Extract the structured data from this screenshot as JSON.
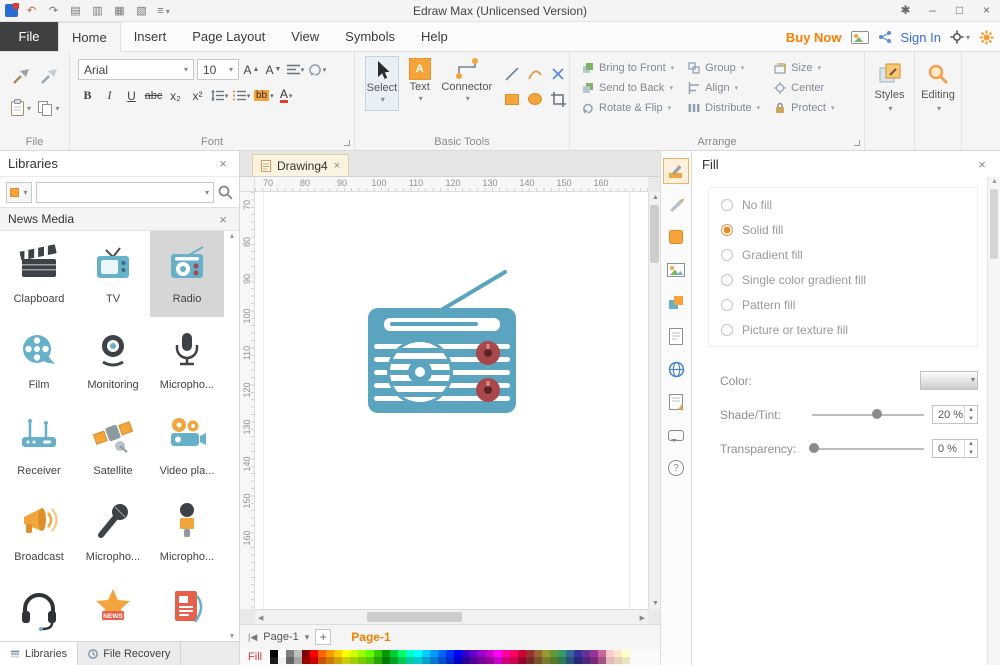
{
  "titlebar": {
    "title": "Edraw Max (Unlicensed Version)"
  },
  "tabs": {
    "file": "File",
    "items": [
      "Home",
      "Insert",
      "Page Layout",
      "View",
      "Symbols",
      "Help"
    ],
    "buy_now": "Buy Now",
    "sign_in": "Sign In"
  },
  "ribbon": {
    "groups": {
      "file": "File",
      "font": "Font",
      "basic_tools": "Basic Tools",
      "arrange": "Arrange"
    },
    "font": {
      "family": "Arial",
      "size": "10",
      "bold": "B",
      "italic": "I",
      "underline": "U",
      "strike": "abc",
      "subscript": "x₂",
      "superscript": "x²",
      "highlight": "bb",
      "color": "A"
    },
    "tools": {
      "select": "Select",
      "text": "Text",
      "connector": "Connector"
    },
    "arrange": {
      "bring_to_front": "Bring to Front",
      "send_to_back": "Send to Back",
      "rotate_flip": "Rotate & Flip",
      "group": "Group",
      "align": "Align",
      "distribute": "Distribute",
      "size": "Size",
      "center": "Center",
      "protect": "Protect"
    },
    "styles": "Styles",
    "editing": "Editing"
  },
  "library": {
    "title": "Libraries",
    "section": "News Media",
    "items": [
      {
        "label": "Clapboard"
      },
      {
        "label": "TV"
      },
      {
        "label": "Radio",
        "selected": true
      },
      {
        "label": "Film"
      },
      {
        "label": "Monitoring"
      },
      {
        "label": "Micropho..."
      },
      {
        "label": "Receiver"
      },
      {
        "label": "Satellite"
      },
      {
        "label": "Video pla..."
      },
      {
        "label": "Broadcast"
      },
      {
        "label": "Micropho..."
      },
      {
        "label": "Micropho..."
      },
      {
        "label": ""
      },
      {
        "label": ""
      },
      {
        "label": ""
      }
    ],
    "tabs": [
      "Libraries",
      "File Recovery"
    ]
  },
  "canvas": {
    "doc_tab": "Drawing4",
    "h_ruler": [
      "70",
      "80",
      "90",
      "100",
      "110",
      "120",
      "130",
      "140",
      "150",
      "160"
    ],
    "v_ruler": [
      "70",
      "80",
      "90",
      "100",
      "110",
      "120",
      "130",
      "140",
      "150",
      "160"
    ],
    "page_nav_label": "Page-1",
    "active_page": "Page-1",
    "add_page": "+"
  },
  "fill_panel": {
    "title": "Fill",
    "options": [
      {
        "label": "No fill",
        "selected": false
      },
      {
        "label": "Solid fill",
        "selected": true
      },
      {
        "label": "Gradient fill",
        "selected": false
      },
      {
        "label": "Single color gradient fill",
        "selected": false
      },
      {
        "label": "Pattern fill",
        "selected": false
      },
      {
        "label": "Picture or texture fill",
        "selected": false
      }
    ],
    "color_label": "Color:",
    "shade_label": "Shade/Tint:",
    "shade_value": "20 %",
    "shade_percent": 58,
    "transparency_label": "Transparency:",
    "transparency_value": "0 %",
    "transparency_percent": 2
  },
  "bottom": {
    "fill_label": "Fill",
    "palette_row1": [
      "#000000",
      "#ffffff",
      "#808080",
      "#c0c0c0",
      "#800000",
      "#ff0000",
      "#ff6600",
      "#ff9900",
      "#ffcc00",
      "#ffff00",
      "#ccff00",
      "#99ff00",
      "#66ff00",
      "#33cc00",
      "#009900",
      "#00cc33",
      "#00ff66",
      "#00ffcc",
      "#00ffff",
      "#00ccff",
      "#0099ff",
      "#0066ff",
      "#0033ff",
      "#0000ff",
      "#3300cc",
      "#6600cc",
      "#9900cc",
      "#cc00cc",
      "#ff00ff",
      "#ff0099",
      "#ff0066",
      "#cc0033",
      "#993333",
      "#996633",
      "#999933",
      "#669933",
      "#339966",
      "#336699",
      "#333399",
      "#663399",
      "#993399",
      "#cc6699",
      "#ffcccc",
      "#ffe5cc",
      "#ffffcc"
    ],
    "palette_row2": [
      "#1a1a1a",
      "#f2f2f2",
      "#666666",
      "#a6a6a6",
      "#990000",
      "#cc0000",
      "#cc5200",
      "#cc7a00",
      "#cca300",
      "#cccc00",
      "#a3cc00",
      "#7acc00",
      "#52cc00",
      "#29a300",
      "#007a00",
      "#00a329",
      "#00cc52",
      "#00cca3",
      "#00cccc",
      "#00a3cc",
      "#007acc",
      "#0052cc",
      "#0029cc",
      "#0000cc",
      "#290099",
      "#520099",
      "#7a0099",
      "#990099",
      "#cc00cc",
      "#cc007a",
      "#cc0052",
      "#990029",
      "#7a2929",
      "#7a5229",
      "#7a7a29",
      "#527a29",
      "#297a52",
      "#29527a",
      "#29297a",
      "#52297a",
      "#7a297a",
      "#a35285",
      "#e6b8b8",
      "#e6cfb8",
      "#e6e6b8"
    ]
  }
}
